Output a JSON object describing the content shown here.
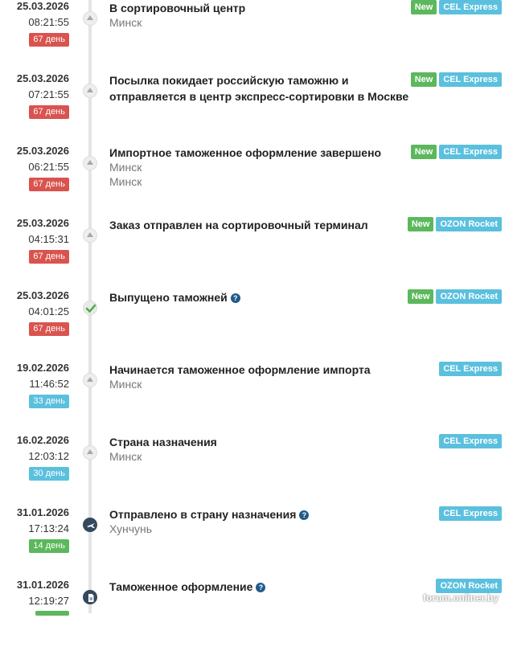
{
  "events": [
    {
      "date": "25.03.2026",
      "time": "08:21:55",
      "days": "67 день",
      "days_color": "red",
      "marker": "up",
      "title": "В сортировочный центр",
      "location": "Минск",
      "new": "New",
      "service": "CEL Express"
    },
    {
      "date": "25.03.2026",
      "time": "07:21:55",
      "days": "67 день",
      "days_color": "red",
      "marker": "up",
      "title": "Посылка покидает российскую таможню и отправляется в центр экспресс-сортировки в Москве",
      "location": "Минск",
      "new": "New",
      "service": "CEL Express"
    },
    {
      "date": "25.03.2026",
      "time": "06:21:55",
      "days": "67 день",
      "days_color": "red",
      "marker": "up",
      "title": "Импортное таможенное оформление завершено",
      "location": "Минск",
      "new": "New",
      "service": "CEL Express"
    },
    {
      "date": "25.03.2026",
      "time": "04:15:31",
      "days": "67 день",
      "days_color": "red",
      "marker": "up",
      "title": "Заказ отправлен на сортировочный терминал",
      "location": "",
      "new": "New",
      "service": "OZON Rocket"
    },
    {
      "date": "25.03.2026",
      "time": "04:01:25",
      "days": "67 день",
      "days_color": "red",
      "marker": "check",
      "title": "Выпущено таможней",
      "help": "?",
      "location": "",
      "new": "New",
      "service": "OZON Rocket"
    },
    {
      "date": "19.02.2026",
      "time": "11:46:52",
      "days": "33 день",
      "days_color": "blue",
      "marker": "up",
      "title": "Начинается таможенное оформление импорта",
      "location": "Минск",
      "new": "",
      "service": "CEL Express"
    },
    {
      "date": "16.02.2026",
      "time": "12:03:12",
      "days": "30 день",
      "days_color": "blue",
      "marker": "up",
      "title": "Страна назначения",
      "location": "Минск",
      "new": "",
      "service": "CEL Express"
    },
    {
      "date": "31.01.2026",
      "time": "17:13:24",
      "days": "14 день",
      "days_color": "green",
      "marker": "plane",
      "title": "Отправлено в страну назначения",
      "help": "?",
      "location": "Хунчунь",
      "new": "",
      "service": "CEL Express"
    },
    {
      "date": "31.01.2026",
      "time": "12:19:27",
      "days": "",
      "days_color": "green",
      "marker": "doc",
      "title": "Таможенное оформление",
      "help": "?",
      "location": "",
      "new": "",
      "service": "OZON Rocket"
    }
  ],
  "watermark": "forum.onliner.by",
  "colors": {
    "red": "#d9534f",
    "blue": "#5bc0de",
    "green": "#5cb85c",
    "new": "#5cb85c",
    "service": "#5bc0de",
    "dark_marker": "#34495e"
  }
}
